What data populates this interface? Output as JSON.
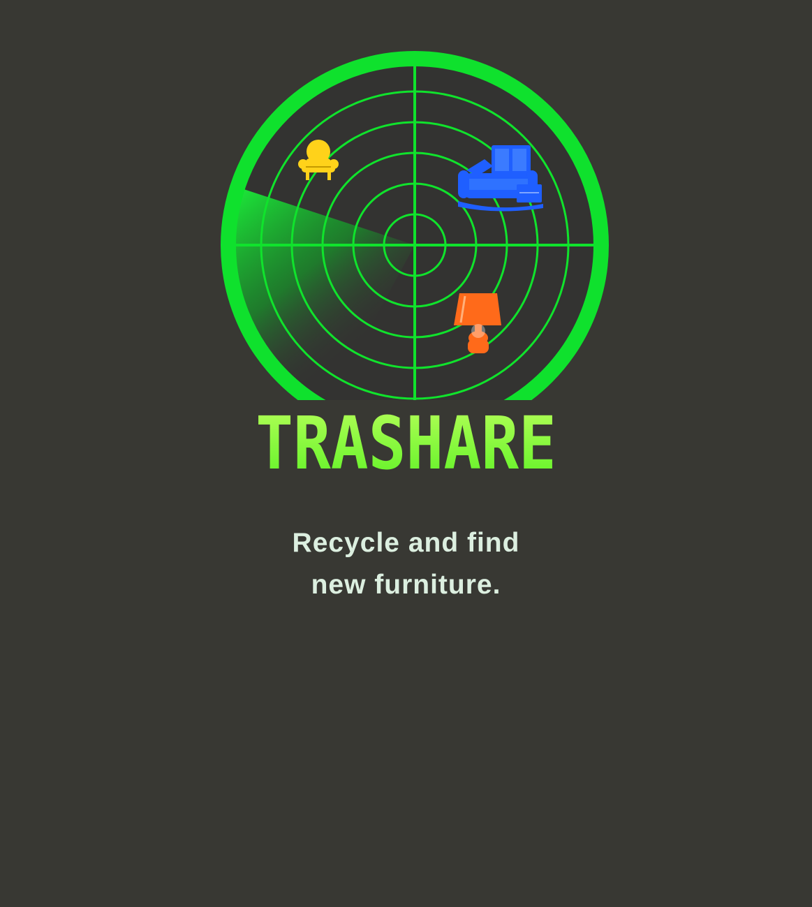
{
  "brand": {
    "name": "TRASHARE",
    "colors": {
      "radar": "#10e32c",
      "title_top": "#b7ff5a",
      "title_bottom": "#5df225",
      "background": "#383833",
      "tagline": "#dcefe0"
    }
  },
  "tagline": {
    "line1": "Recycle and find",
    "line2": "new furniture."
  },
  "blips": [
    {
      "icon": "armchair-icon",
      "color": "#ffd21a"
    },
    {
      "icon": "furniture-pile-icon",
      "color": "#1f5fff"
    },
    {
      "icon": "lamp-icon",
      "color": "#ff6a1a"
    }
  ]
}
